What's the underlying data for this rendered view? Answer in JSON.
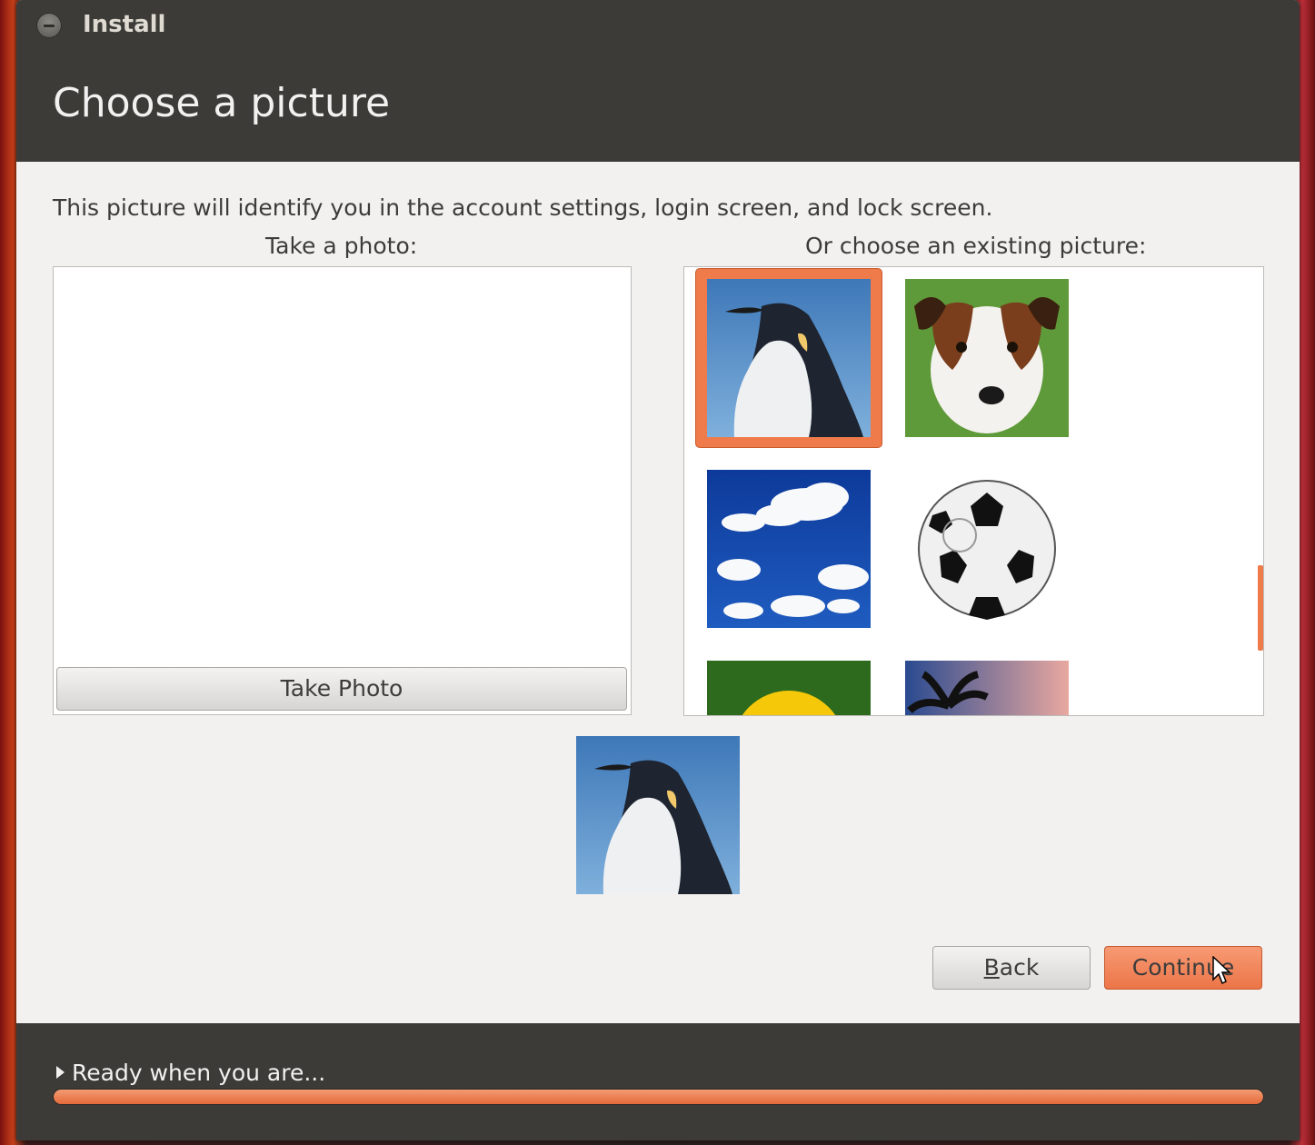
{
  "window": {
    "title": "Install"
  },
  "page": {
    "title": "Choose a picture",
    "description": "This picture will identify you in the account settings, login screen, and lock screen."
  },
  "take_photo": {
    "label": "Take a photo:",
    "button": "Take Photo"
  },
  "existing": {
    "label": "Or choose an existing picture:",
    "pictures": [
      "penguin",
      "dog",
      "clouds",
      "soccer-ball",
      "sunflower",
      "palm-tree"
    ],
    "selected": "penguin"
  },
  "buttons": {
    "back_mnemonic": "B",
    "back_rest": "ack",
    "continue": "Continue"
  },
  "footer": {
    "status": "Ready when you are...",
    "progress_fraction": 1.0
  },
  "colors": {
    "accent": "#ef7b4a",
    "header": "#3c3b37",
    "body": "#f2f1f0"
  }
}
